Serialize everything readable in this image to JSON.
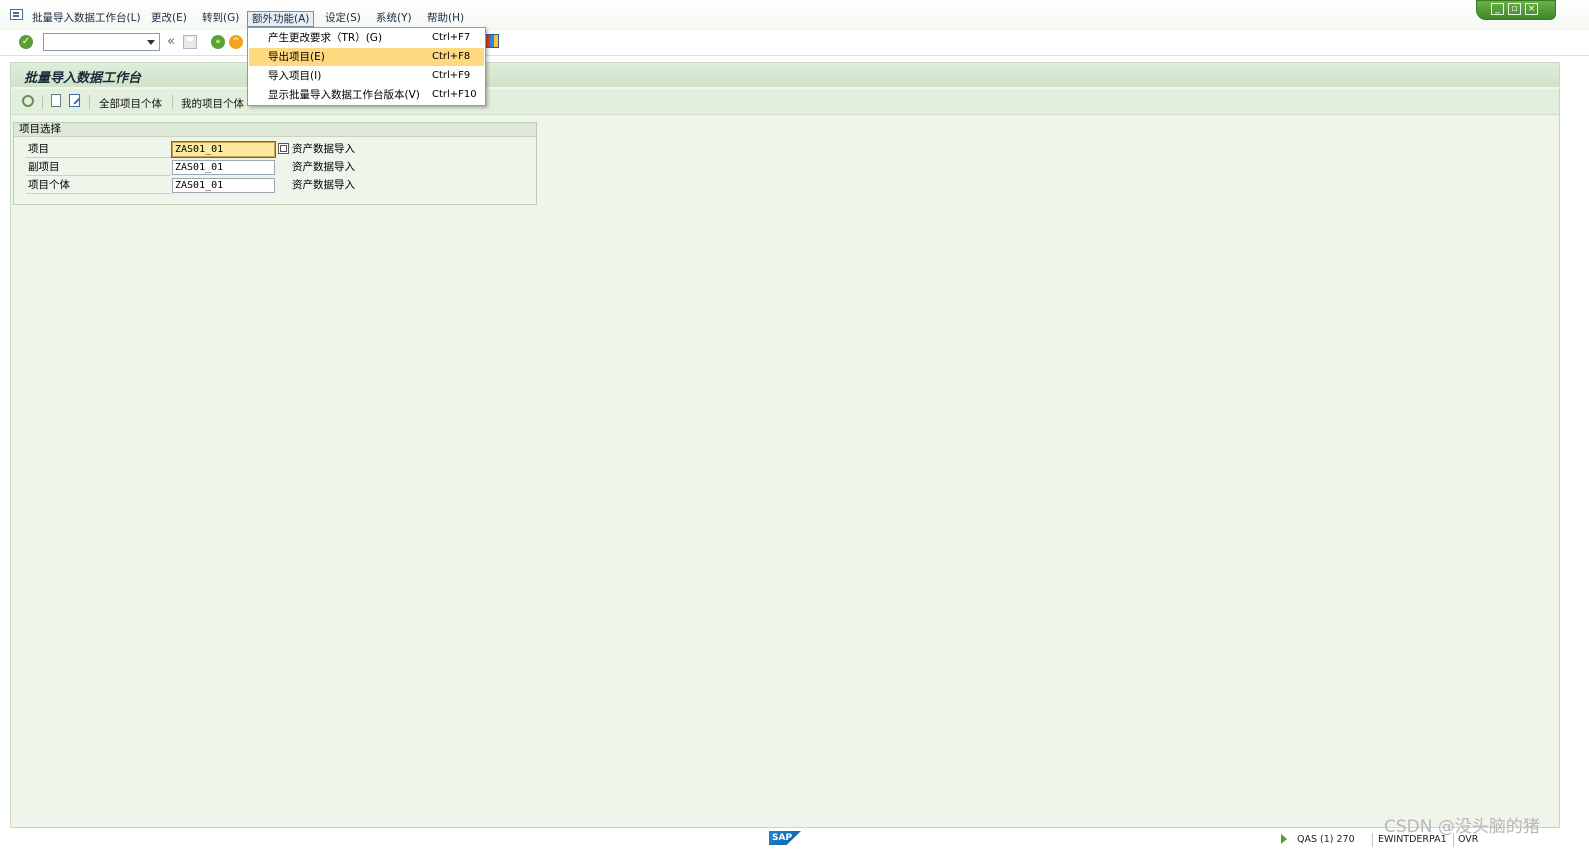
{
  "menubar": {
    "items": [
      {
        "label": "批量导入数据工作台(L)"
      },
      {
        "label": "更改(E)"
      },
      {
        "label": "转到(G)"
      },
      {
        "label": "额外功能(A)"
      },
      {
        "label": "设定(S)"
      },
      {
        "label": "系统(Y)"
      },
      {
        "label": "帮助(H)"
      }
    ]
  },
  "dropdown": {
    "items": [
      {
        "label": "产生更改要求（TR）(G)",
        "shortcut": "Ctrl+F7"
      },
      {
        "label": "导出项目(E)",
        "shortcut": "Ctrl+F8"
      },
      {
        "label": "导入项目(I)",
        "shortcut": "Ctrl+F9"
      },
      {
        "label": "显示批量导入数据工作台版本(V)",
        "shortcut": "Ctrl+F10"
      }
    ],
    "highlighted_index": 1
  },
  "toolbar": {
    "command_value": "",
    "back_glyph": "«"
  },
  "page": {
    "title": "批量导入数据工作台",
    "buttons": {
      "all_runs": "全部项目个体",
      "my_runs": "我的项目个体"
    }
  },
  "selection": {
    "title": "项目选择",
    "fields": [
      {
        "label": "项目",
        "value": "ZAS01_01",
        "desc": "资产数据导入"
      },
      {
        "label": "副项目",
        "value": "ZAS01_01",
        "desc": "资产数据导入"
      },
      {
        "label": "项目个体",
        "value": "ZAS01_01",
        "desc": "资产数据导入"
      }
    ]
  },
  "statusbar": {
    "logo": "SAP",
    "system": "QAS (1) 270",
    "server": "EWINTDERPA1",
    "mode": "OVR"
  },
  "watermark": "CSDN @没头脑的猪",
  "colors": {
    "highlight": "#ffd980",
    "panel_bg": "#eff5eb",
    "accent_green": "#5a9e34"
  }
}
